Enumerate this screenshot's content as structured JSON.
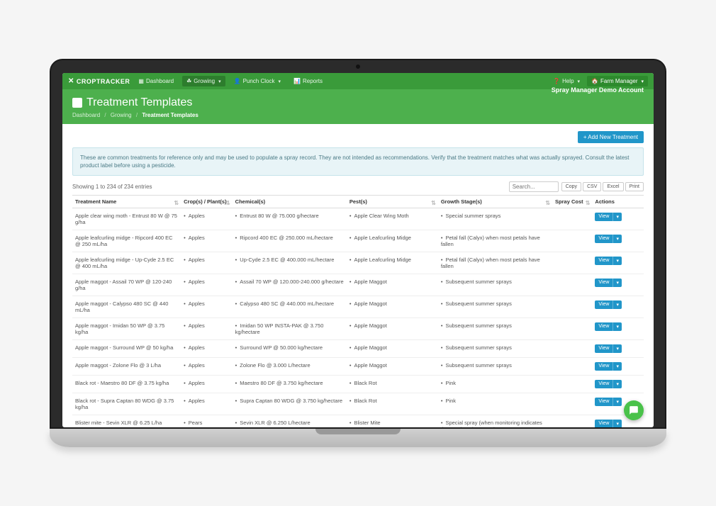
{
  "brand": "CROPTRACKER",
  "nav": {
    "dashboard": "Dashboard",
    "growing": "Growing",
    "punch_clock": "Punch Clock",
    "reports": "Reports",
    "help": "Help",
    "farm_manager": "Farm Manager"
  },
  "header": {
    "title": "Treatment Templates",
    "account": "Spray Manager Demo Account",
    "breadcrumb": {
      "dashboard": "Dashboard",
      "growing": "Growing",
      "current": "Treatment Templates"
    }
  },
  "buttons": {
    "add_new": "+ Add New Treatment",
    "view": "View",
    "copy": "Copy",
    "csv": "CSV",
    "excel": "Excel",
    "print": "Print"
  },
  "alert": "These are common treatments for reference only and may be used to populate a spray record. They are not intended as recommendations. Verify that the treatment matches what was actually sprayed. Consult the latest product label before using a pesticide.",
  "entries_info": "Showing 1 to 234 of 234 entries",
  "search_placeholder": "Search...",
  "columns": {
    "name": "Treatment Name",
    "crops": "Crop(s) / Plant(s)",
    "chemicals": "Chemical(s)",
    "pests": "Pest(s)",
    "stages": "Growth Stage(s)",
    "cost": "Spray Cost",
    "actions": "Actions"
  },
  "rows": [
    {
      "name": "Apple clear wing moth - Entrust 80 W @ 75 g/ha",
      "crops": "Apples",
      "chemicals": "Entrust 80 W @ 75.000 g/hectare",
      "pests": "Apple Clear Wing Moth",
      "stages": "Special summer sprays",
      "cost": ""
    },
    {
      "name": "Apple leafcurling midge - Ripcord 400 EC @ 250 mL/ha",
      "crops": "Apples",
      "chemicals": "Ripcord 400 EC @ 250.000 mL/hectare",
      "pests": "Apple Leafcurling Midge",
      "stages": "Petal fall (Calyx) when most petals have fallen",
      "cost": ""
    },
    {
      "name": "Apple leafcurling midge - Up-Cyde 2.5 EC @ 400 mL/ha",
      "crops": "Apples",
      "chemicals": "Up-Cyde 2.5 EC @ 400.000 mL/hectare",
      "pests": "Apple Leafcurling Midge",
      "stages": "Petal fall (Calyx) when most petals have fallen",
      "cost": ""
    },
    {
      "name": "Apple maggot - Assail 70 WP @ 120-240 g/ha",
      "crops": "Apples",
      "chemicals": "Assail 70 WP @ 120.000-240.000 g/hectare",
      "pests": "Apple Maggot",
      "stages": "Subsequent summer sprays",
      "cost": ""
    },
    {
      "name": "Apple maggot - Calypso 480 SC @ 440 mL/ha",
      "crops": "Apples",
      "chemicals": "Calypso 480 SC @ 440.000 mL/hectare",
      "pests": "Apple Maggot",
      "stages": "Subsequent summer sprays",
      "cost": ""
    },
    {
      "name": "Apple maggot - Imidan 50 WP @ 3.75 kg/ha",
      "crops": "Apples",
      "chemicals": "Imidan 50 WP INSTA-PAK @ 3.750 kg/hectare",
      "pests": "Apple Maggot",
      "stages": "Subsequent summer sprays",
      "cost": ""
    },
    {
      "name": "Apple maggot - Surround WP @ 50 kg/ha",
      "crops": "Apples",
      "chemicals": "Surround WP @ 50.000 kg/hectare",
      "pests": "Apple Maggot",
      "stages": "Subsequent summer sprays",
      "cost": ""
    },
    {
      "name": "Apple maggot - Zolone Flo @ 3 L/ha",
      "crops": "Apples",
      "chemicals": "Zolone Flo @ 3.000 L/hectare",
      "pests": "Apple Maggot",
      "stages": "Subsequent summer sprays",
      "cost": ""
    },
    {
      "name": "Black rot - Maestro 80 DF @ 3.75 kg/ha",
      "crops": "Apples",
      "chemicals": "Maestro 80 DF @ 3.750 kg/hectare",
      "pests": "Black Rot",
      "stages": "Pink",
      "cost": ""
    },
    {
      "name": "Black rot - Supra Captan 80 WDG @ 3.75 kg/ha",
      "crops": "Apples",
      "chemicals": "Supra Captan 80 WDG @ 3.750 kg/hectare",
      "pests": "Black Rot",
      "stages": "Pink",
      "cost": ""
    },
    {
      "name": "Blister mite - Sevin XLR @ 6.25 L/ha",
      "crops": "Pears",
      "chemicals": "Sevin XLR @ 6.250 L/hectare",
      "pests": "Blister Mite",
      "stages": "Special spray (when monitoring indicates the need at First cover)",
      "cost": ""
    }
  ]
}
